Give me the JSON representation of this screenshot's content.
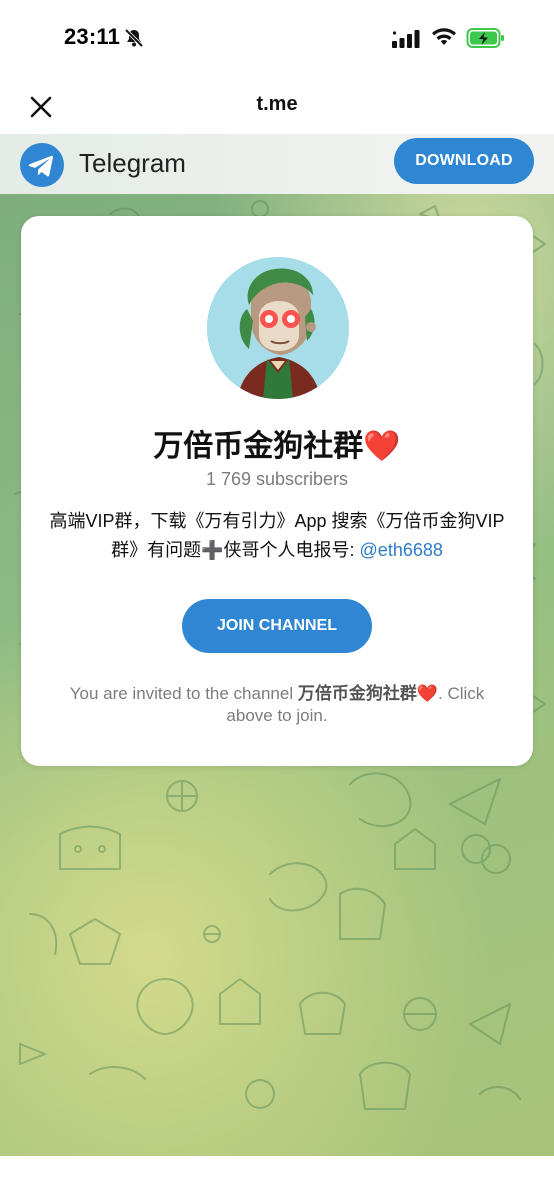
{
  "status_bar": {
    "time": "23:11"
  },
  "nav": {
    "title": "t.me"
  },
  "header": {
    "brand": "Telegram",
    "download_label": "DOWNLOAD"
  },
  "channel": {
    "name": "万倍币金狗社群❤️",
    "subscribers": "1 769 subscribers",
    "description_text": "高端VIP群，下载《万有引力》App 搜索《万倍币金狗VIP群》有问题➕侠哥个人电报号: ",
    "description_link": "@eth6688",
    "join_label": "JOIN CHANNEL",
    "invite_prefix": "You are invited to the channel ",
    "invite_name": "万倍币金狗社群❤️",
    "invite_suffix": ". Click above to join."
  },
  "colors": {
    "accent": "#2f87d4",
    "link": "#2f7cc7"
  }
}
